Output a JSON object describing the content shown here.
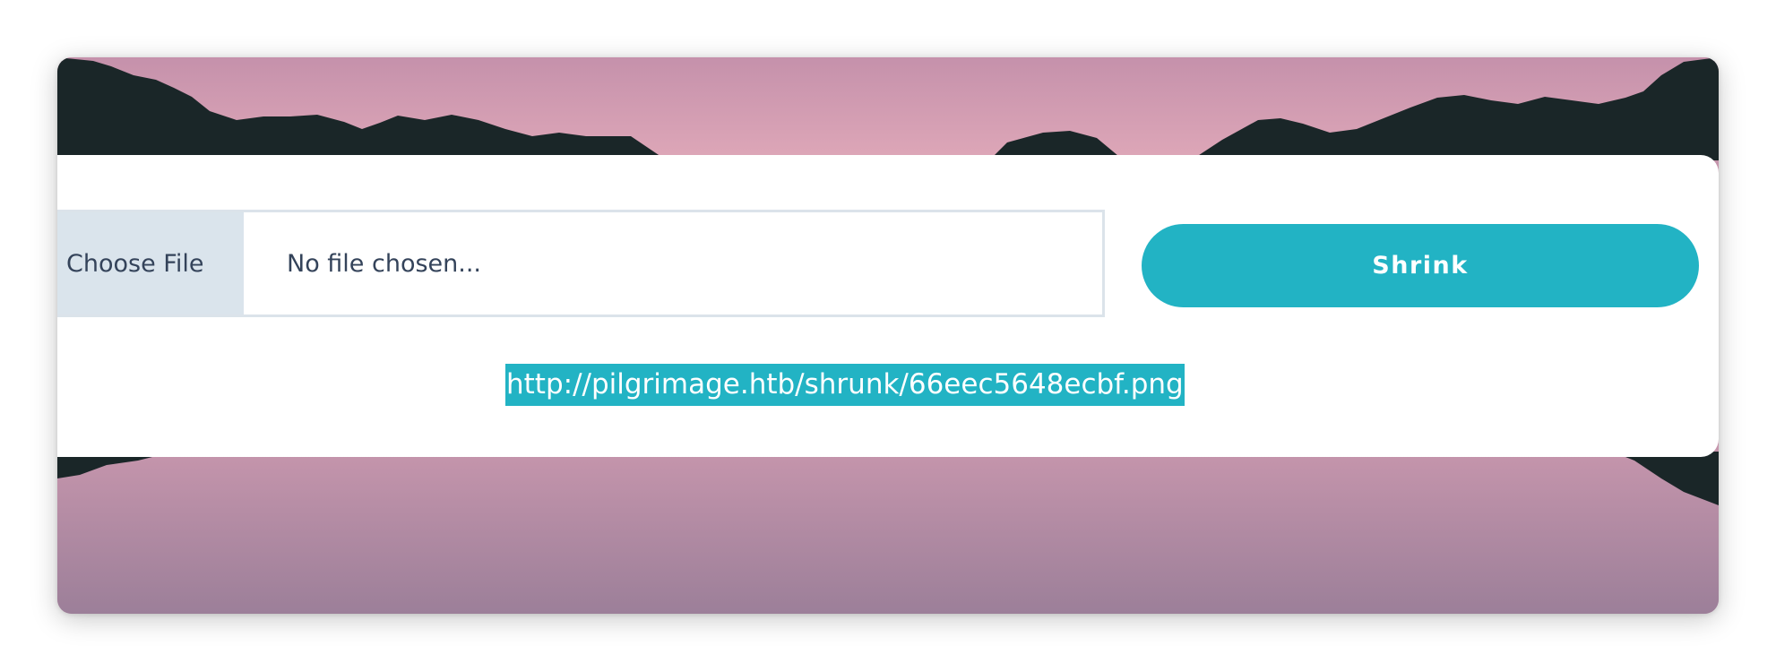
{
  "colors": {
    "sky_top": "#c591ab",
    "sky_horizon": "#dea7b8",
    "mountains": "#1a2628",
    "lake_top": "#c595ac",
    "lake_bottom": "#9c7f99",
    "accent": "#22b3c4",
    "file_label_bg": "#dae4ec",
    "text": "#34435a"
  },
  "upload": {
    "choose_file_label": "Choose File",
    "file_status": "No file chosen..."
  },
  "actions": {
    "shrink_label": "Shrink"
  },
  "result": {
    "url": "http://pilgrimage.htb/shrunk/66eec5648ecbf.png"
  }
}
